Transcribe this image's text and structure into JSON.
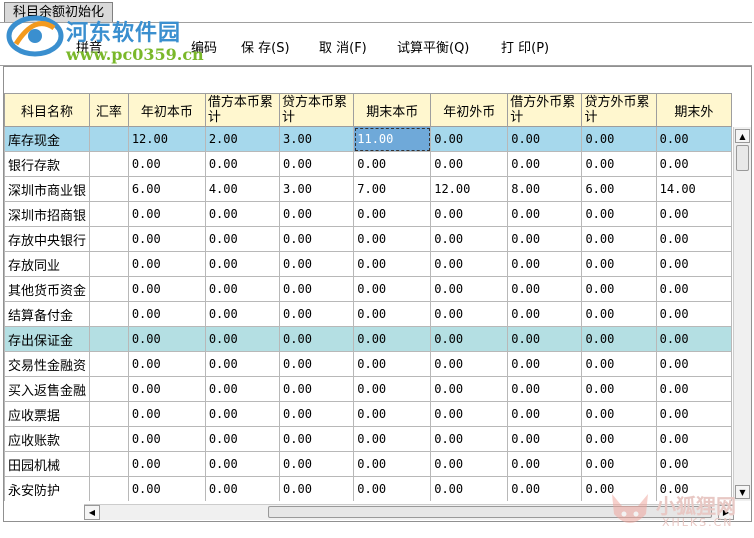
{
  "window": {
    "tab_title": "科目余额初始化"
  },
  "watermark": {
    "title": "河东软件园",
    "url": "www.pc0359.cn"
  },
  "toolbar": {
    "pinyin": "拼音",
    "code": "编码",
    "save": "保 存(S)",
    "cancel": "取 消(F)",
    "balance": "试算平衡(Q)",
    "print": "打 印(P)"
  },
  "table": {
    "headers": [
      "科目名称",
      "汇率",
      "年初本币",
      "借方本币累计",
      "贷方本币累计",
      "期末本币",
      "年初外币",
      "借方外币累计",
      "贷方外币累计",
      "期末外"
    ],
    "rows": [
      [
        "库存现金",
        "",
        "12.00",
        "2.00",
        "3.00",
        "11.00",
        "0.00",
        "0.00",
        "0.00",
        "0.00"
      ],
      [
        "银行存款",
        "",
        "0.00",
        "0.00",
        "0.00",
        "0.00",
        "0.00",
        "0.00",
        "0.00",
        "0.00"
      ],
      [
        "深圳市商业银",
        "",
        "6.00",
        "4.00",
        "3.00",
        "7.00",
        "12.00",
        "8.00",
        "6.00",
        "14.00"
      ],
      [
        "深圳市招商银",
        "",
        "0.00",
        "0.00",
        "0.00",
        "0.00",
        "0.00",
        "0.00",
        "0.00",
        "0.00"
      ],
      [
        "存放中央银行",
        "",
        "0.00",
        "0.00",
        "0.00",
        "0.00",
        "0.00",
        "0.00",
        "0.00",
        "0.00"
      ],
      [
        "存放同业",
        "",
        "0.00",
        "0.00",
        "0.00",
        "0.00",
        "0.00",
        "0.00",
        "0.00",
        "0.00"
      ],
      [
        "其他货币资金",
        "",
        "0.00",
        "0.00",
        "0.00",
        "0.00",
        "0.00",
        "0.00",
        "0.00",
        "0.00"
      ],
      [
        "结算备付金",
        "",
        "0.00",
        "0.00",
        "0.00",
        "0.00",
        "0.00",
        "0.00",
        "0.00",
        "0.00"
      ],
      [
        "存出保证金",
        "",
        "0.00",
        "0.00",
        "0.00",
        "0.00",
        "0.00",
        "0.00",
        "0.00",
        "0.00"
      ],
      [
        "交易性金融资",
        "",
        "0.00",
        "0.00",
        "0.00",
        "0.00",
        "0.00",
        "0.00",
        "0.00",
        "0.00"
      ],
      [
        "买入返售金融",
        "",
        "0.00",
        "0.00",
        "0.00",
        "0.00",
        "0.00",
        "0.00",
        "0.00",
        "0.00"
      ],
      [
        "应收票据",
        "",
        "0.00",
        "0.00",
        "0.00",
        "0.00",
        "0.00",
        "0.00",
        "0.00",
        "0.00"
      ],
      [
        "应收账款",
        "",
        "0.00",
        "0.00",
        "0.00",
        "0.00",
        "0.00",
        "0.00",
        "0.00",
        "0.00"
      ],
      [
        "田园机械",
        "",
        "0.00",
        "0.00",
        "0.00",
        "0.00",
        "0.00",
        "0.00",
        "0.00",
        "0.00"
      ],
      [
        "永安防护",
        "",
        "0.00",
        "0.00",
        "0.00",
        "0.00",
        "0.00",
        "0.00",
        "0.00",
        "0.00"
      ]
    ],
    "selected_row": 0,
    "highlight_row": 8
  },
  "colors": {
    "header_bg": "#fff7cf",
    "selected_row": "#a6d8ec",
    "highlight_row": "#b4dfe3",
    "editing_cell": "#6fa9d9"
  },
  "corner_watermark": {
    "text": "小狐狸网",
    "sub": "XHLKS.CN"
  }
}
